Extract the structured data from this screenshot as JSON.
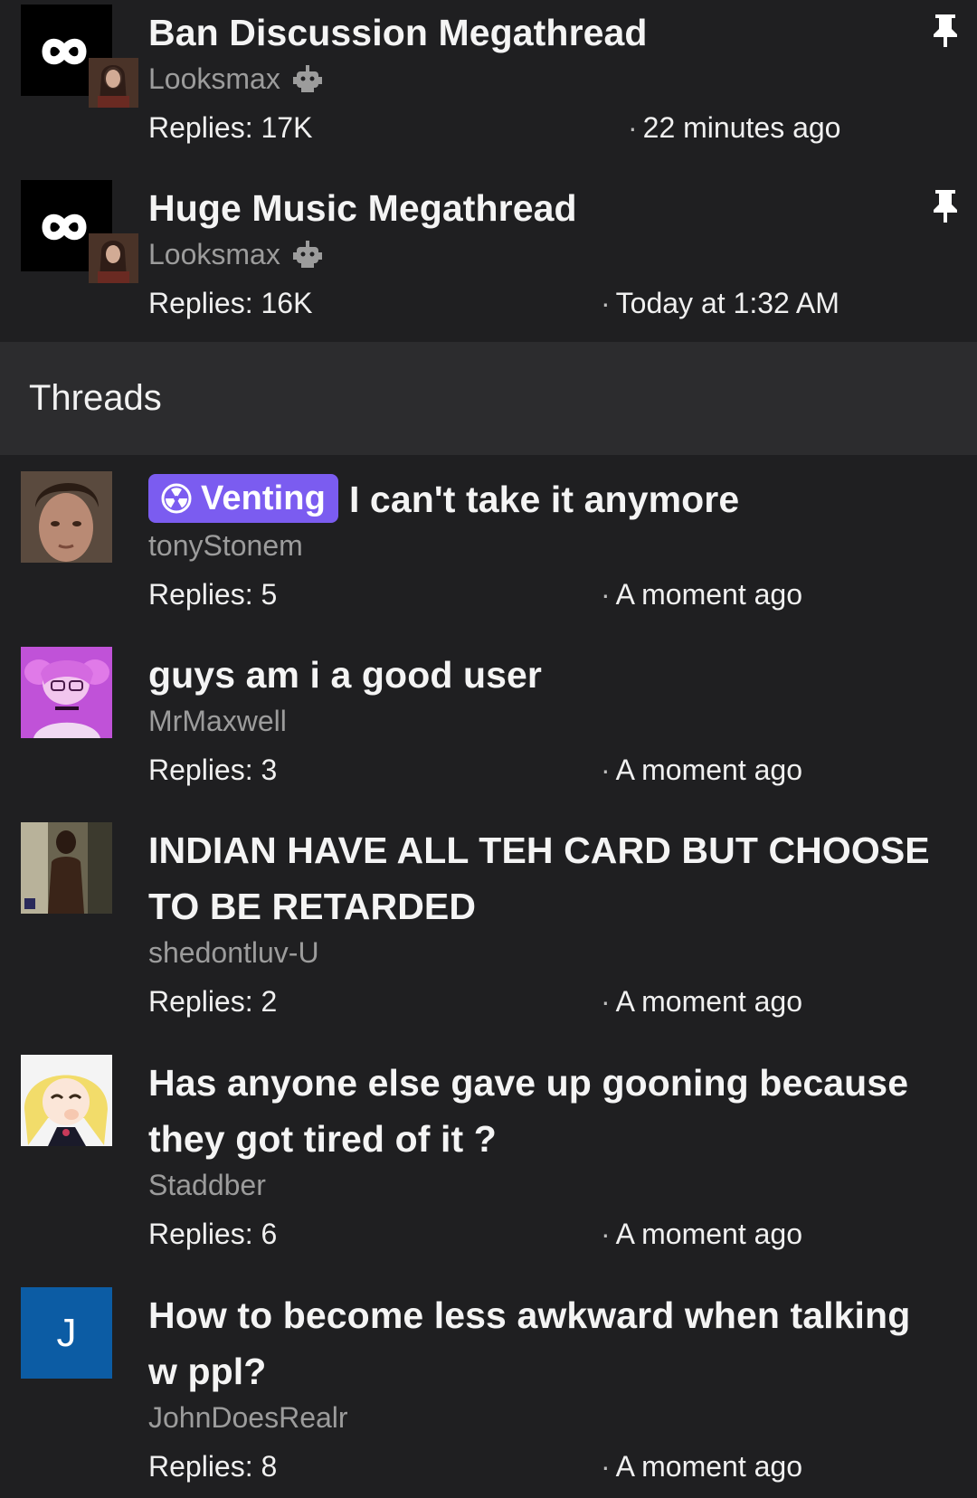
{
  "sticky": [
    {
      "title": "Ban Discussion Megathread",
      "author": "Looksmax",
      "replies": "Replies: 17K",
      "sep": "·",
      "time": "22 minutes ago"
    },
    {
      "title": "Huge Music Megathread",
      "author": "Looksmax",
      "replies": "Replies: 16K",
      "sep": "·",
      "time": "Today at 1:32 AM"
    }
  ],
  "section": {
    "title": "Threads"
  },
  "threads": [
    {
      "prefix": "Venting",
      "title": "I can't take it anymore",
      "author": "tonyStonem",
      "replies": "Replies: 5",
      "sep": "·",
      "time": "A moment ago"
    },
    {
      "title": "guys am i a good user",
      "author": "MrMaxwell",
      "replies": "Replies: 3",
      "sep": "·",
      "time": "A moment ago"
    },
    {
      "title": "INDIAN HAVE ALL TEH CARD BUT CHOOSE TO BE RETARDED",
      "author": "shedontluv-U",
      "replies": "Replies: 2",
      "sep": "·",
      "time": "A moment ago"
    },
    {
      "title": "Has anyone else gave up gooning because they got tired of it ?",
      "author": "Staddber",
      "replies": "Replies: 6",
      "sep": "·",
      "time": "A moment ago"
    },
    {
      "title": "How to become less awkward when talking w ppl?",
      "author": "JohnDoesRealr",
      "avatar_letter": "J",
      "replies": "Replies: 8",
      "sep": "·",
      "time": "A moment ago"
    }
  ],
  "colors": {
    "background": "#1f1f21",
    "section_bg": "#2c2c2e",
    "prefix_venting": "#7b5cf0",
    "letter_avatar": "#0c5ca4"
  }
}
